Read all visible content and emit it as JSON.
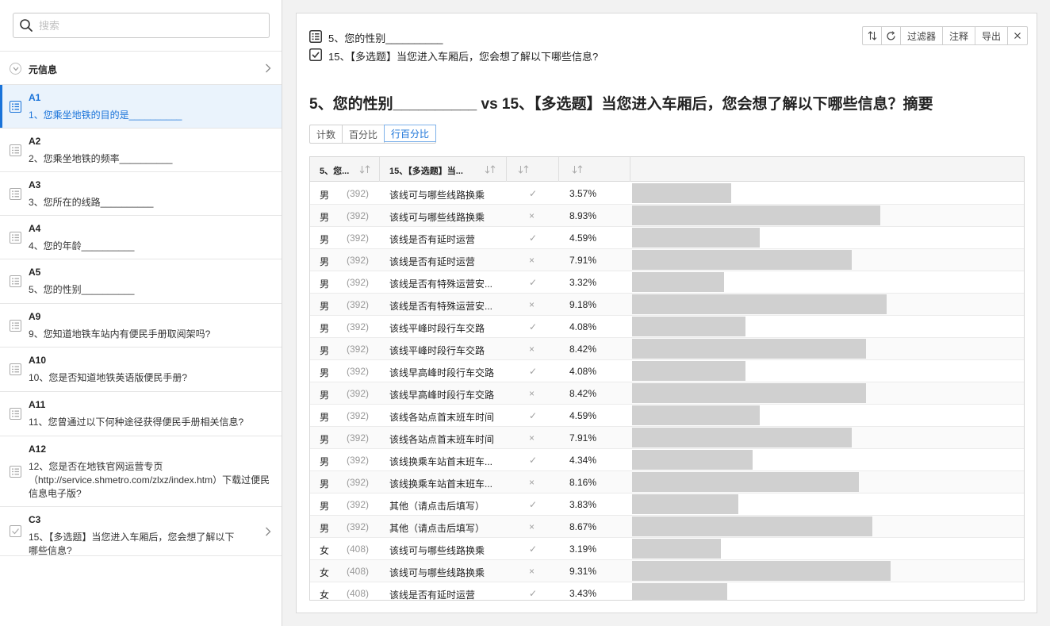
{
  "search": {
    "placeholder": "搜索"
  },
  "meta": {
    "label": "元信息"
  },
  "questions": [
    {
      "code": "A1",
      "text": "1、您乘坐地铁的目的是__________",
      "icon": "list-icon",
      "active": true
    },
    {
      "code": "A2",
      "text": "2、您乘坐地铁的频率__________",
      "icon": "list-icon"
    },
    {
      "code": "A3",
      "text": "3、您所在的线路__________",
      "icon": "list-icon"
    },
    {
      "code": "A4",
      "text": "4、您的年龄__________",
      "icon": "list-icon"
    },
    {
      "code": "A5",
      "text": "5、您的性别__________",
      "icon": "list-icon"
    },
    {
      "code": "A9",
      "text": "9、您知道地铁车站内有便民手册取阅架吗?",
      "icon": "list-icon"
    },
    {
      "code": "A10",
      "text": "10、您是否知道地铁英语版便民手册?",
      "icon": "list-icon"
    },
    {
      "code": "A11",
      "text": "11、您曾通过以下何种途径获得便民手册相关信息?",
      "icon": "list-icon"
    },
    {
      "code": "A12",
      "text": "12、您是否在地铁官网运营专页（http://service.shmetro.com/zlxz/index.htm）下载过便民信息电子版?",
      "icon": "list-icon"
    },
    {
      "code": "C3",
      "text": "15、【多选题】当您进入车厢后，您会想了解以下哪些信息?",
      "icon": "checkbox-icon",
      "chevron": true
    }
  ],
  "selection": {
    "q1": "5、您的性别__________",
    "q2": "15、【多选题】当您进入车厢后，您会想了解以下哪些信息?"
  },
  "toolbar": {
    "filter": "过滤器",
    "notes": "注释",
    "export": "导出"
  },
  "summary_title": "5、您的性别__________ vs 15、【多选题】当您进入车厢后，您会想了解以下哪些信息？摘要",
  "view_modes": {
    "count": "计数",
    "percent": "百分比",
    "row_percent": "行百分比",
    "selected": "row_percent"
  },
  "table": {
    "headers": {
      "col1": "5、您...",
      "col2": "15、【多选题】当..."
    },
    "rows": [
      {
        "g": "男",
        "n": "(392)",
        "opt": "该线可与哪些线路换乘",
        "m": "✓",
        "pct": "3.57%",
        "v": 3.57
      },
      {
        "g": "男",
        "n": "(392)",
        "opt": "该线可与哪些线路换乘",
        "m": "×",
        "pct": "8.93%",
        "v": 8.93
      },
      {
        "g": "男",
        "n": "(392)",
        "opt": "该线是否有延时运营",
        "m": "✓",
        "pct": "4.59%",
        "v": 4.59
      },
      {
        "g": "男",
        "n": "(392)",
        "opt": "该线是否有延时运营",
        "m": "×",
        "pct": "7.91%",
        "v": 7.91
      },
      {
        "g": "男",
        "n": "(392)",
        "opt": "该线是否有特殊运营安...",
        "m": "✓",
        "pct": "3.32%",
        "v": 3.32
      },
      {
        "g": "男",
        "n": "(392)",
        "opt": "该线是否有特殊运营安...",
        "m": "×",
        "pct": "9.18%",
        "v": 9.18
      },
      {
        "g": "男",
        "n": "(392)",
        "opt": "该线平峰时段行车交路",
        "m": "✓",
        "pct": "4.08%",
        "v": 4.08
      },
      {
        "g": "男",
        "n": "(392)",
        "opt": "该线平峰时段行车交路",
        "m": "×",
        "pct": "8.42%",
        "v": 8.42
      },
      {
        "g": "男",
        "n": "(392)",
        "opt": "该线早高峰时段行车交路",
        "m": "✓",
        "pct": "4.08%",
        "v": 4.08
      },
      {
        "g": "男",
        "n": "(392)",
        "opt": "该线早高峰时段行车交路",
        "m": "×",
        "pct": "8.42%",
        "v": 8.42
      },
      {
        "g": "男",
        "n": "(392)",
        "opt": "该线各站点首末班车时间",
        "m": "✓",
        "pct": "4.59%",
        "v": 4.59
      },
      {
        "g": "男",
        "n": "(392)",
        "opt": "该线各站点首末班车时间",
        "m": "×",
        "pct": "7.91%",
        "v": 7.91
      },
      {
        "g": "男",
        "n": "(392)",
        "opt": "该线换乘车站首末班车...",
        "m": "✓",
        "pct": "4.34%",
        "v": 4.34
      },
      {
        "g": "男",
        "n": "(392)",
        "opt": "该线换乘车站首末班车...",
        "m": "×",
        "pct": "8.16%",
        "v": 8.16
      },
      {
        "g": "男",
        "n": "(392)",
        "opt": "其他（请点击后填写）",
        "m": "✓",
        "pct": "3.83%",
        "v": 3.83
      },
      {
        "g": "男",
        "n": "(392)",
        "opt": "其他（请点击后填写）",
        "m": "×",
        "pct": "8.67%",
        "v": 8.67
      },
      {
        "g": "女",
        "n": "(408)",
        "opt": "该线可与哪些线路换乘",
        "m": "✓",
        "pct": "3.19%",
        "v": 3.19
      },
      {
        "g": "女",
        "n": "(408)",
        "opt": "该线可与哪些线路换乘",
        "m": "×",
        "pct": "9.31%",
        "v": 9.31
      },
      {
        "g": "女",
        "n": "(408)",
        "opt": "该线是否有延时运营",
        "m": "✓",
        "pct": "3.43%",
        "v": 3.43
      }
    ]
  },
  "colors": {
    "accent": "#1a73d9",
    "bar": "#d0d0d0",
    "active_bg": "#eaf3fc"
  }
}
